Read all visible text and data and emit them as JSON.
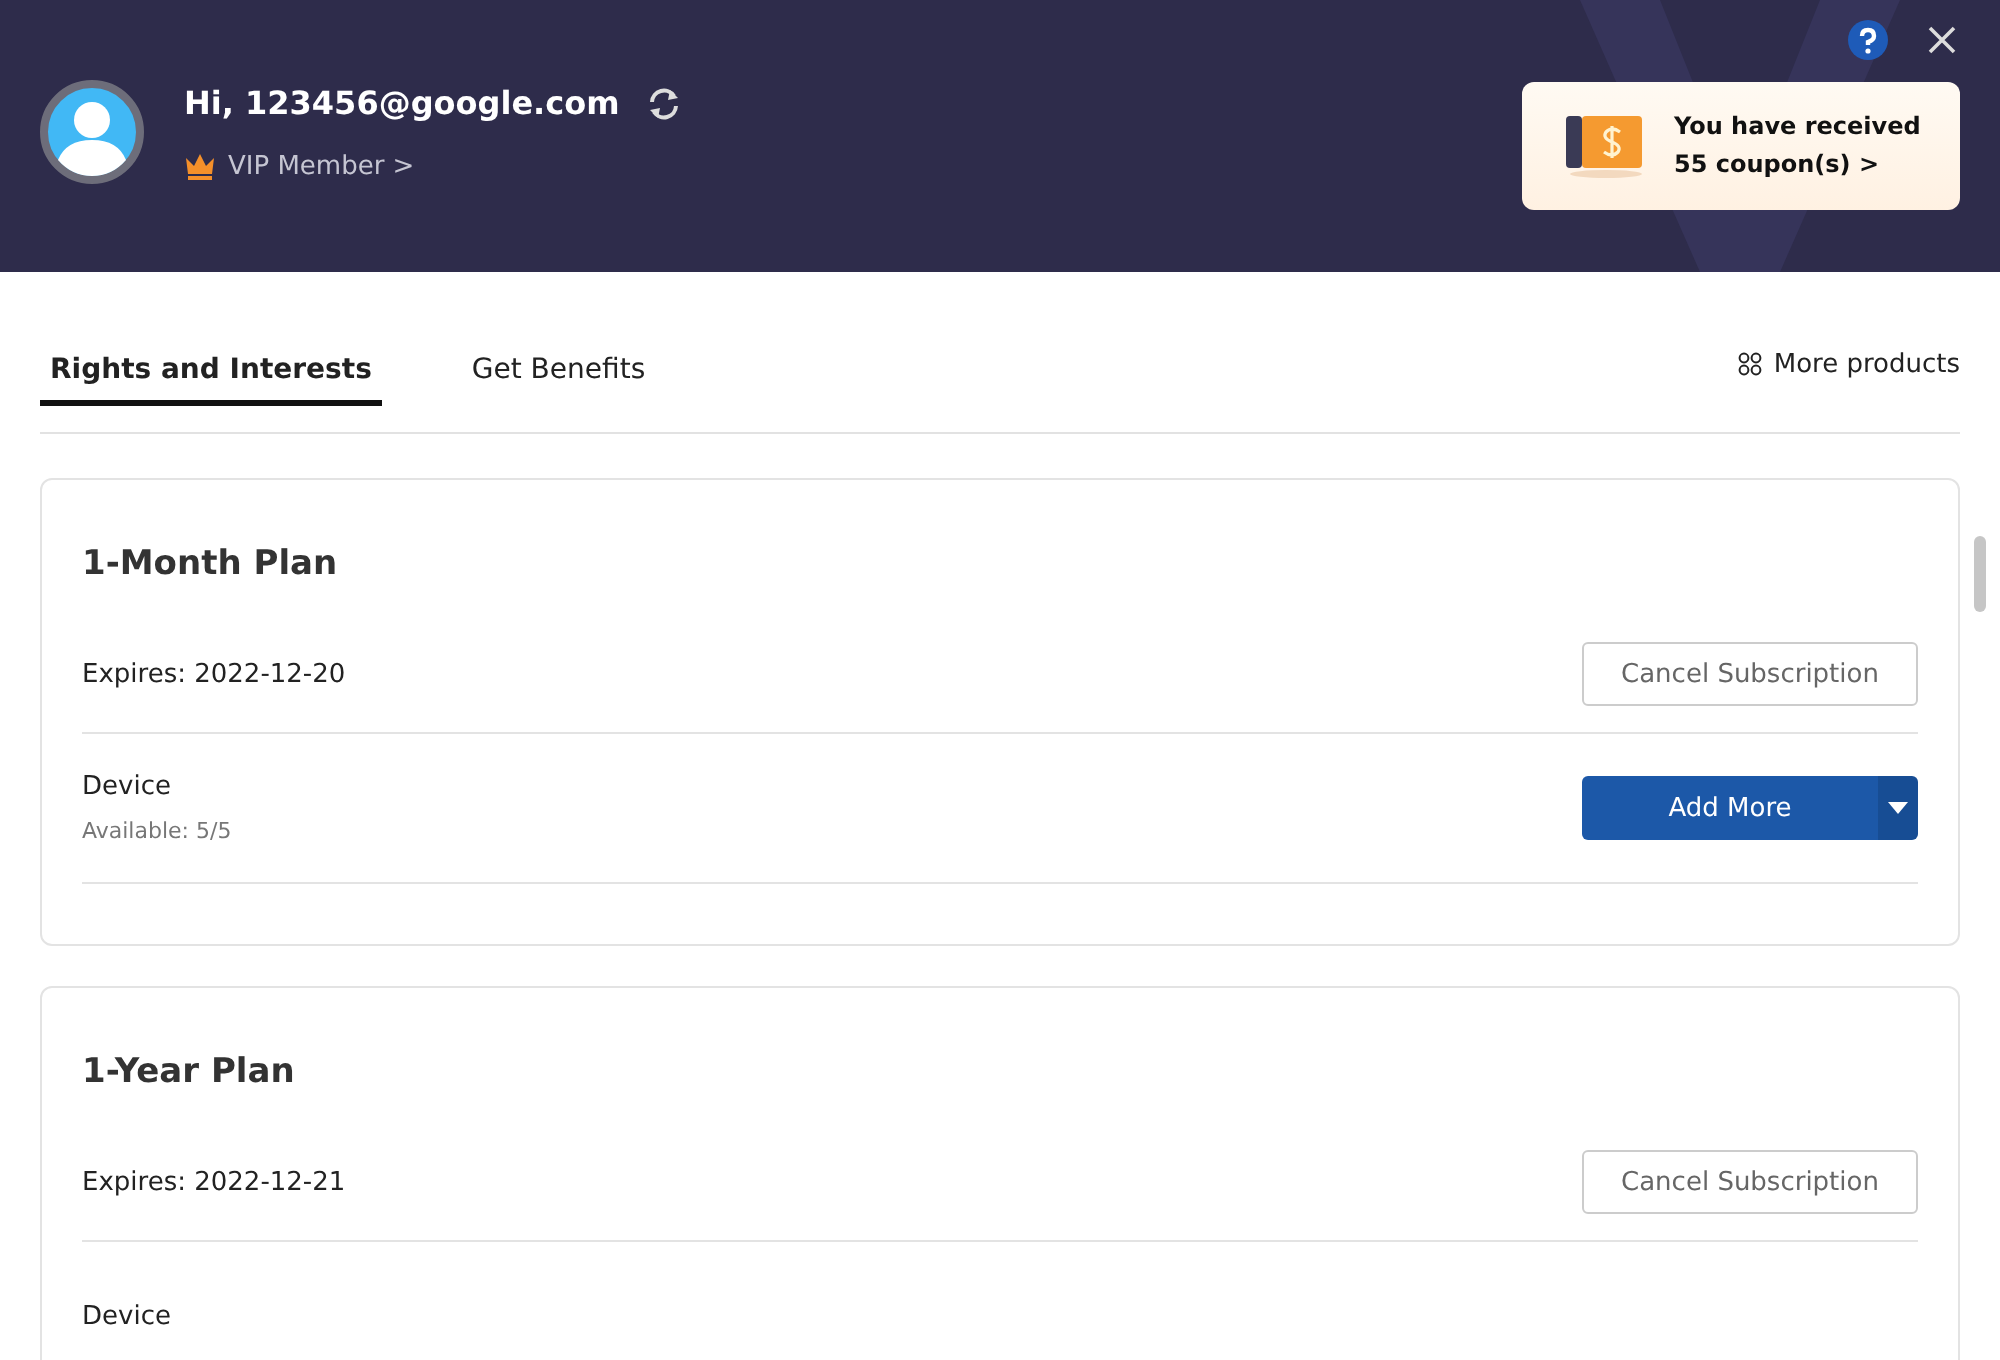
{
  "user": {
    "greeting": "Hi, 123456@google.com",
    "membership": "VIP Member >"
  },
  "coupon": {
    "line1": "You have received",
    "line2": "55 coupon(s) >"
  },
  "tabs": [
    {
      "label": "Rights and Interests",
      "selected": true
    },
    {
      "label": "Get Benefits",
      "selected": false
    }
  ],
  "more_products": "More products",
  "plans": [
    {
      "title": "1-Month Plan",
      "expires": "Expires: 2022-12-20",
      "cancel_button": "Cancel Subscription",
      "device_label": "Device",
      "available": "Available: 5/5",
      "add_button": "Add More"
    },
    {
      "title": "1-Year Plan",
      "expires": "Expires: 2022-12-21",
      "cancel_button": "Cancel Subscription",
      "device_label": "Device"
    }
  ]
}
